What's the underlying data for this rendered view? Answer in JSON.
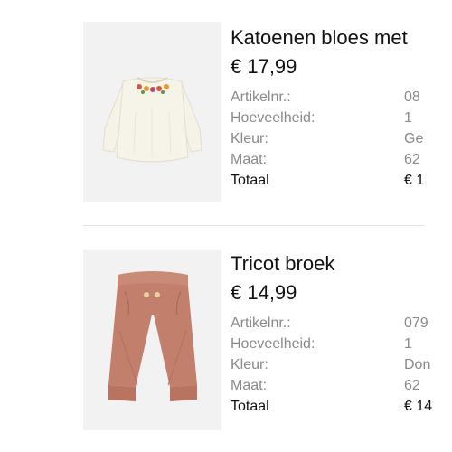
{
  "labels": {
    "article": "Artikelnr.:",
    "quantity": "Hoeveelheid:",
    "color": "Kleur:",
    "size": "Maat:",
    "total": "Totaal"
  },
  "items": [
    {
      "title": "Katoenen bloes met",
      "price": "€ 17,99",
      "article_no": "08",
      "quantity": "1",
      "color": "Ge",
      "size": "62",
      "total": "€ 1",
      "image_icon": "blouse-image",
      "image_color": "#f4f1e6"
    },
    {
      "title": "Tricot broek",
      "price": "€ 14,99",
      "article_no": "079",
      "quantity": "1",
      "color": "Don",
      "size": "62",
      "total": "€ 14",
      "image_icon": "trousers-image",
      "image_color": "#c27f6c"
    }
  ]
}
